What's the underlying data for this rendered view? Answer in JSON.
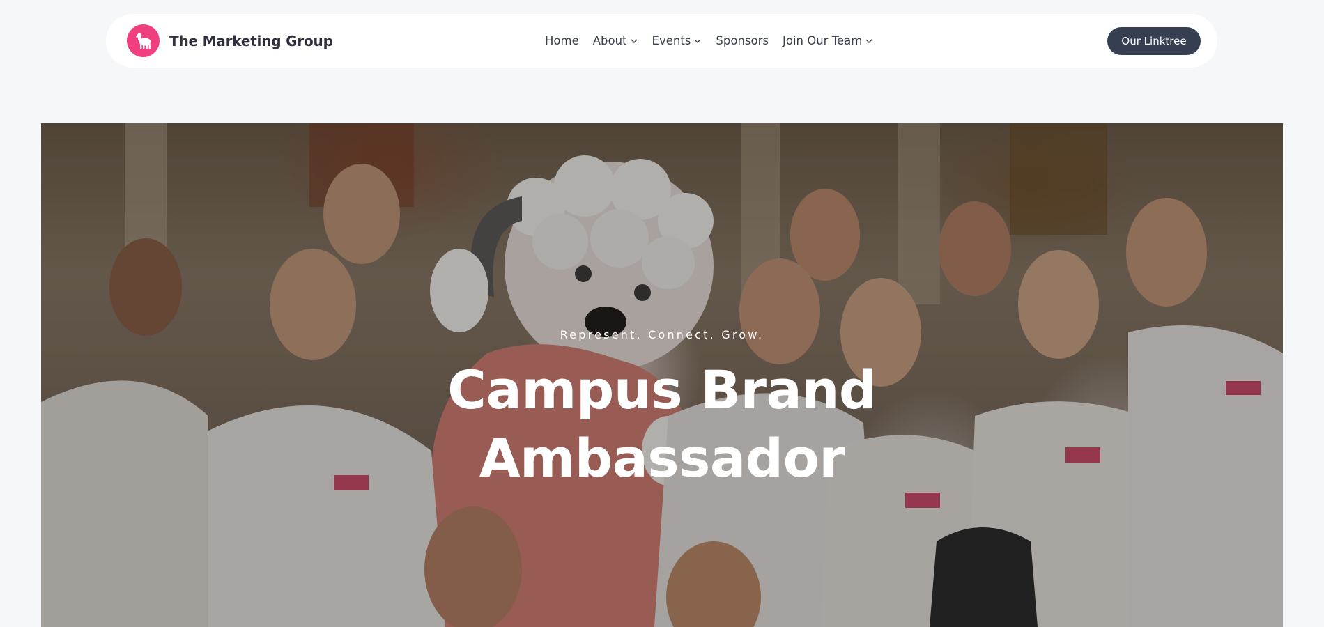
{
  "nav": {
    "brand_name": "The Marketing Group",
    "logo_icon": "lamb-icon",
    "links": [
      {
        "label": "Home",
        "has_dropdown": false
      },
      {
        "label": "About",
        "has_dropdown": true
      },
      {
        "label": "Events",
        "has_dropdown": true
      },
      {
        "label": "Sponsors",
        "has_dropdown": false
      },
      {
        "label": "Join Our Team",
        "has_dropdown": true
      }
    ],
    "cta_label": "Our Linktree"
  },
  "hero": {
    "tagline": "Represent. Connect. Grow.",
    "title_line1": "Campus Brand",
    "title_line2": "Ambassador",
    "image_subject": "group-photo-ambassadors-with-lamb-mascot"
  },
  "colors": {
    "brand_pink": "#ef3f7f",
    "cta_bg": "#363f51",
    "page_bg": "#f6f7f8",
    "nav_text": "#3a3f4b"
  }
}
